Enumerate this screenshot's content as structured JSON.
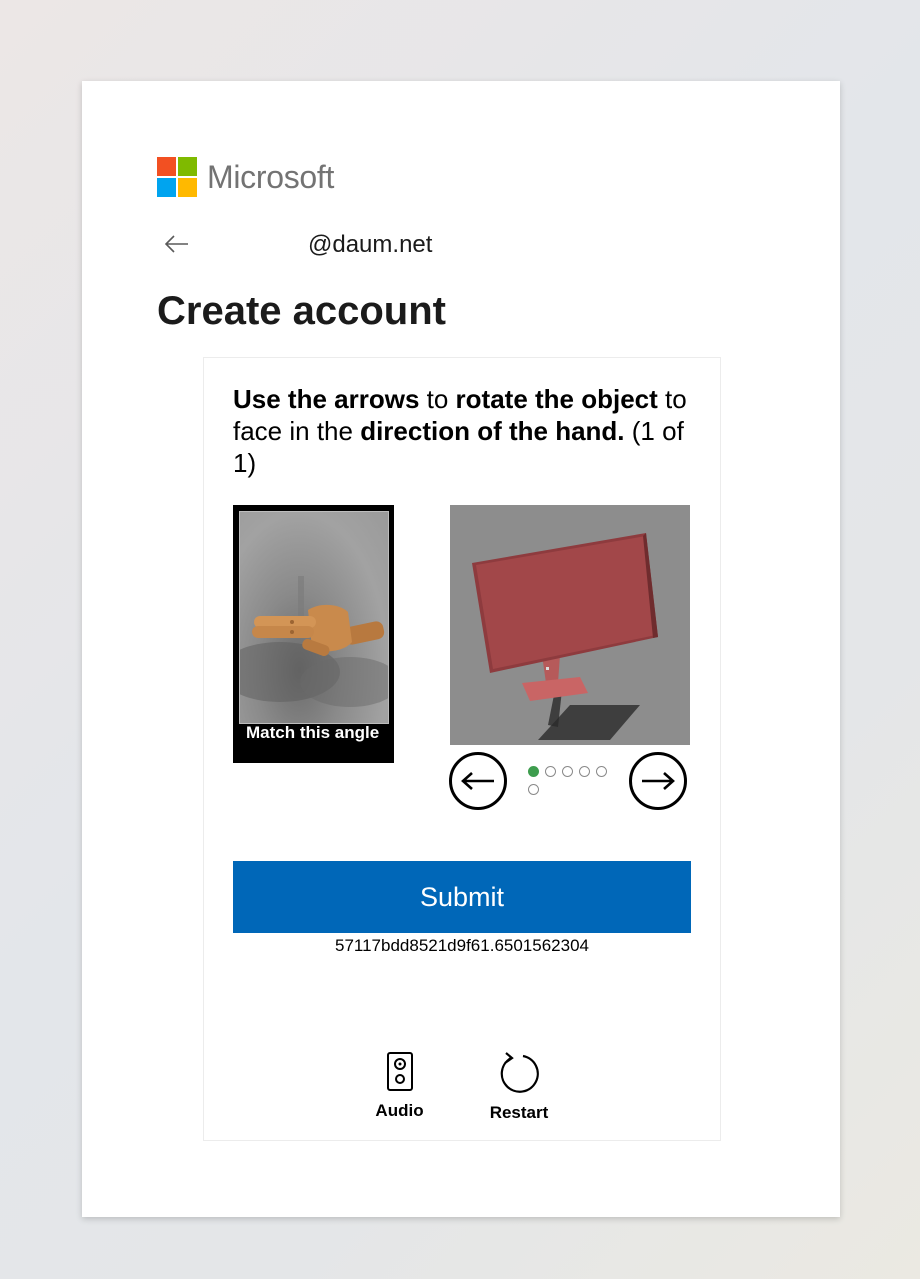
{
  "brand": {
    "name": "Microsoft",
    "colors": [
      "#f25022",
      "#7fba00",
      "#00a4ef",
      "#ffb900"
    ]
  },
  "identity": {
    "back_icon": "arrow-left-icon",
    "email": "@daum.net"
  },
  "page": {
    "title": "Create account"
  },
  "challenge": {
    "instruction": {
      "part1_bold": "Use the arrows",
      "part2": " to ",
      "part3_bold": "rotate the object",
      "part4": " to face in the ",
      "part5_bold": "direction of the hand.",
      "part6": " (1 of 1)"
    },
    "reference_caption": "Match this angle",
    "prev_icon": "arrow-left-circle-icon",
    "next_icon": "arrow-right-circle-icon",
    "position_total": 6,
    "position_current": 1,
    "accent_color": "#3e9d4e"
  },
  "submit": {
    "label": "Submit",
    "color": "#0067b8"
  },
  "session_id": "57117bdd8521d9f61.6501562304",
  "tools": {
    "audio_label": "Audio",
    "audio_icon": "speaker-icon",
    "restart_label": "Restart",
    "restart_icon": "restart-icon"
  }
}
